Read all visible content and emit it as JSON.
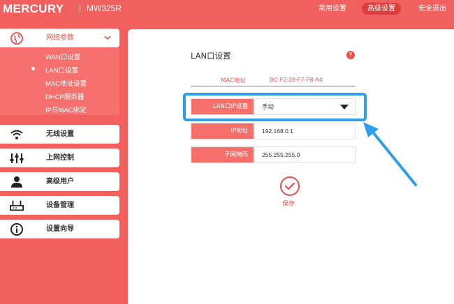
{
  "header": {
    "logo": "MERCURY",
    "model": "MW325R",
    "nav": [
      {
        "label": "常用设置"
      },
      {
        "label": "高级设置"
      },
      {
        "label": "安全退出"
      }
    ]
  },
  "sidebar": {
    "items": [
      {
        "label": "网络参数",
        "icon": "globe-icon"
      },
      {
        "label": "无线设置",
        "icon": "wifi-icon"
      },
      {
        "label": "上网控制",
        "icon": "sliders-icon"
      },
      {
        "label": "高级用户",
        "icon": "user-icon"
      },
      {
        "label": "设备管理",
        "icon": "router-icon"
      },
      {
        "label": "设置向导",
        "icon": "info-icon"
      }
    ],
    "submenu": [
      {
        "label": "WAN口设置"
      },
      {
        "label": "LAN口设置"
      },
      {
        "label": "MAC地址设置"
      },
      {
        "label": "DHCP服务器"
      },
      {
        "label": "IP与MAC绑定"
      }
    ]
  },
  "main": {
    "title": "LAN口设置",
    "help": "?",
    "mac": {
      "label": "MAC地址",
      "value": "BC-F2-28-F7-F8-A4"
    },
    "lan_ip_mode": {
      "label": "LAN口IP设置",
      "value": "手动"
    },
    "ip": {
      "label": "IP地址",
      "value": "192.168.0.1"
    },
    "mask": {
      "label": "子网掩码",
      "value": "255.255.255.0"
    },
    "save": "保存"
  },
  "colors": {
    "background": "#f1605d",
    "label_fill": "#f66f6b",
    "highlight": "#2f9ee9"
  }
}
